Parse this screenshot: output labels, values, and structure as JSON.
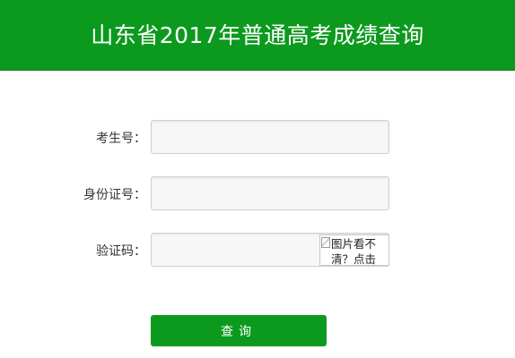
{
  "header": {
    "title": "山东省2017年普通高考成绩查询"
  },
  "form": {
    "exam_number": {
      "label": "考生号：",
      "value": ""
    },
    "id_number": {
      "label": "身份证号：",
      "value": ""
    },
    "captcha": {
      "label": "验证码：",
      "value": "",
      "image_alt": "图片看不清？点击"
    },
    "submit_label": "查询"
  },
  "colors": {
    "brand_green": "#0c9a1e",
    "input_background": "#f7f7f7",
    "input_border": "#d0d0d0"
  },
  "icons": {
    "captcha_image": "broken-image-icon"
  }
}
